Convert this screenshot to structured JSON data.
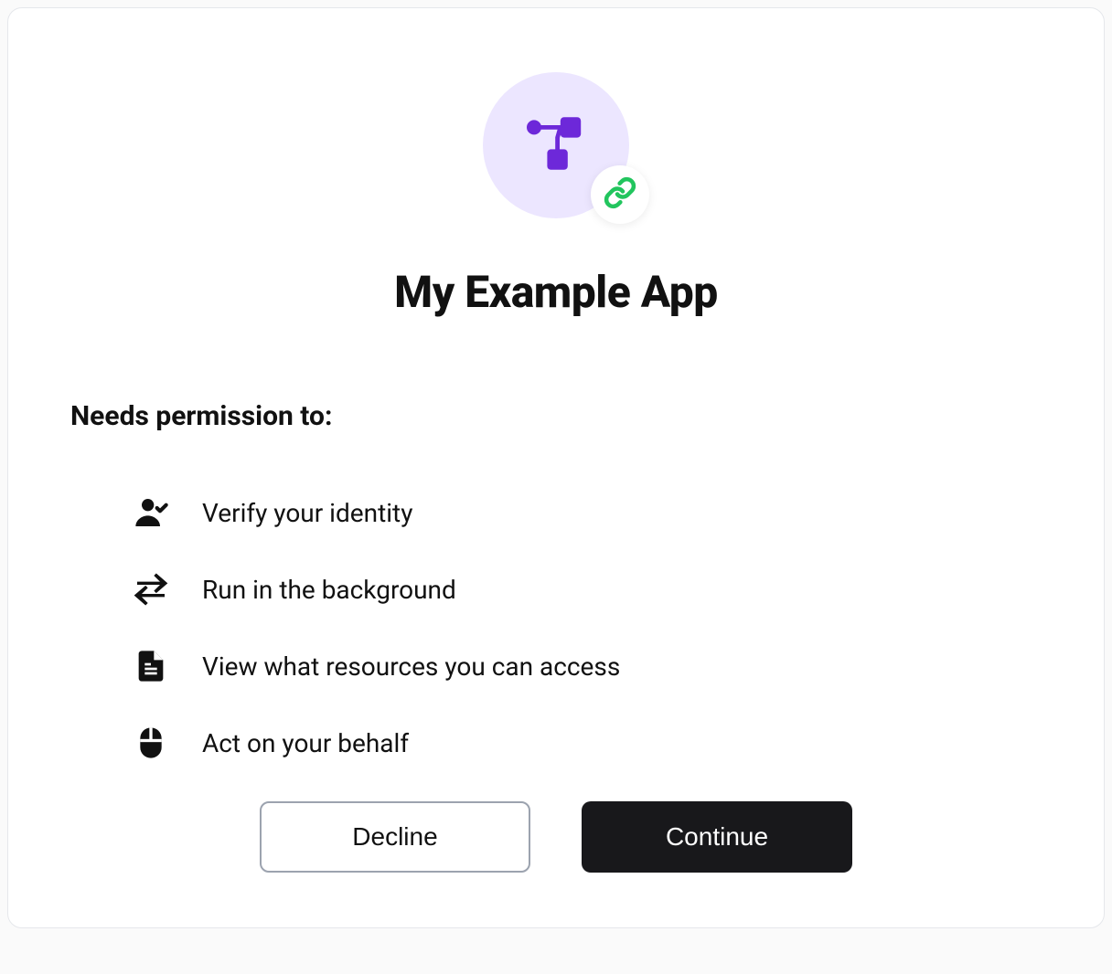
{
  "app": {
    "title": "My Example App"
  },
  "permissions": {
    "heading": "Needs permission to:",
    "items": [
      {
        "icon": "user-check",
        "label": "Verify your identity"
      },
      {
        "icon": "swap-arrows",
        "label": "Run in the background"
      },
      {
        "icon": "file-text",
        "label": "View what resources you can access"
      },
      {
        "icon": "mouse",
        "label": "Act on your behalf"
      }
    ]
  },
  "buttons": {
    "decline": "Decline",
    "continue": "Continue"
  },
  "colors": {
    "accent": "#6d28d9",
    "logoBg": "#ece6ff",
    "link": "#22c55e",
    "primaryBtn": "#18181b"
  }
}
